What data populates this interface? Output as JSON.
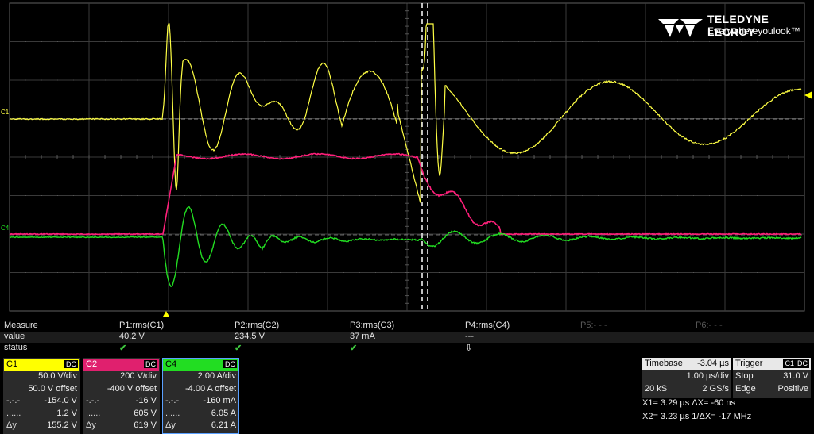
{
  "logo": {
    "brand": "TELEDYNE LECROY",
    "tagline": "Everywhereyoulook™"
  },
  "markers": {
    "c1": "C1",
    "c4": "C4"
  },
  "measure": {
    "row_labels": [
      "Measure",
      "value",
      "status"
    ],
    "params": [
      {
        "name": "P1:rms(C1)",
        "value": "40.2 V",
        "status": "✔"
      },
      {
        "name": "P2:rms(C2)",
        "value": "234.5 V",
        "status": "✔"
      },
      {
        "name": "P3:rms(C3)",
        "value": "37 mA",
        "status": "✔"
      },
      {
        "name": "P4:rms(C4)",
        "value": "---",
        "status": "⇩"
      },
      {
        "name": "P5:- - -",
        "value": "",
        "status": ""
      },
      {
        "name": "P6:- - -",
        "value": "",
        "status": ""
      }
    ]
  },
  "channels": [
    {
      "name": "C1",
      "coupling": "DC",
      "color": "#ffff00",
      "name_color": "#000000",
      "rows": [
        [
          "",
          "50.0 V/div"
        ],
        [
          "",
          "50.0 V offset"
        ],
        [
          "-.-.-",
          "-154.0 V"
        ],
        [
          "......",
          "1.2 V"
        ],
        [
          "Δy",
          "155.2 V"
        ]
      ]
    },
    {
      "name": "C2",
      "coupling": "DC",
      "color": "#e0206e",
      "name_color": "#ffffff",
      "rows": [
        [
          "",
          "200 V/div"
        ],
        [
          "",
          "-400 V offset"
        ],
        [
          "-.-.-",
          "-16 V"
        ],
        [
          "......",
          "605 V"
        ],
        [
          "Δy",
          "619 V"
        ]
      ]
    },
    {
      "name": "C4",
      "coupling": "DC",
      "color": "#22dd22",
      "name_color": "#000000",
      "rows": [
        [
          "",
          "2.00 A/div"
        ],
        [
          "",
          "-4.00 A offset"
        ],
        [
          "-.-.-",
          "-160 mA"
        ],
        [
          "......",
          "6.05 A"
        ],
        [
          "Δy",
          "6.21 A"
        ]
      ]
    }
  ],
  "timebase": {
    "label": "Timebase",
    "delay": "-3.04 µs",
    "per_div": "1.00 µs/div",
    "samples": "20 kS",
    "rate": "2 GS/s"
  },
  "trigger": {
    "label": "Trigger",
    "source": "C1",
    "coupling": "DC",
    "mode": "Stop",
    "level": "31.0 V",
    "type": "Edge",
    "slope": "Positive"
  },
  "cursors": {
    "line1": "X1= 3.29 µs ΔX=      -60 ns",
    "line2": "X2= 3.23 µs 1/ΔX= -17 MHz"
  }
}
